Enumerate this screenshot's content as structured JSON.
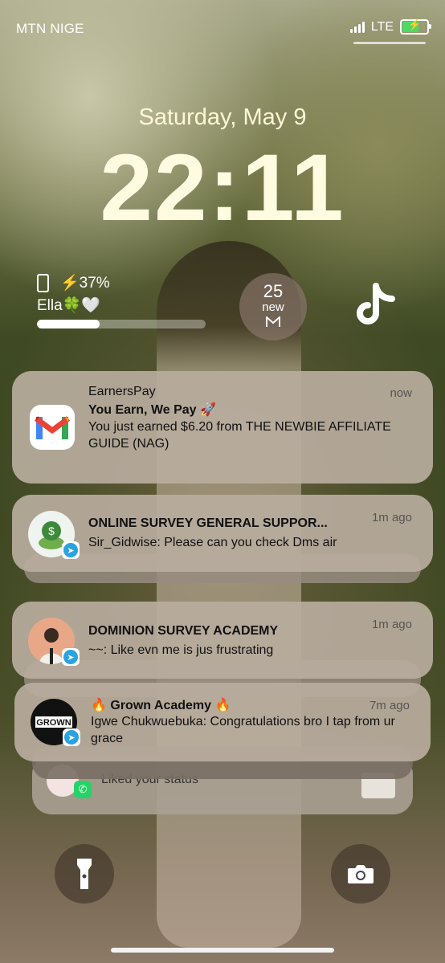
{
  "status_bar": {
    "carrier": "MTN NIGE",
    "network": "LTE",
    "battery_charging": true,
    "battery_level_fraction": 0.7
  },
  "lock_screen": {
    "date": "Saturday, May 9",
    "time": "22:11"
  },
  "widgets": {
    "battery": {
      "percent_label": "⚡37%",
      "device_name": "Ella🍀🤍",
      "level_fraction": 0.37
    },
    "gmail": {
      "count": "25",
      "label": "new"
    },
    "tiktok_icon": "tiktok-icon"
  },
  "notifications": [
    {
      "app": "EarnersPay",
      "title": "You Earn, We Pay 🚀",
      "body": "You just earned $6.20 from THE NEWBIE AFFILIATE GUIDE (NAG)",
      "time": "now",
      "icon": "gmail-icon"
    },
    {
      "title": "ONLINE SURVEY GENERAL SUPPOR...",
      "body": "Sir_Gidwise: Please can you check Dms air",
      "time": "1m ago",
      "icon": "telegram-icon"
    },
    {
      "title": "DOMINION SURVEY ACADEMY",
      "body": "~~: Like evn me is jus frustrating",
      "time": "1m ago",
      "icon": "telegram-icon"
    },
    {
      "title": "🔥 Grown Academy 🔥",
      "body": "Igwe Chukwuebuka: Congratulations bro I tap from ur grace",
      "time": "7m ago",
      "icon": "telegram-icon",
      "avatar_text": "GROWN"
    },
    {
      "body": "Liked your status",
      "icon": "whatsapp-icon"
    }
  ],
  "bottom_controls": {
    "flashlight": "flashlight-icon",
    "camera": "camera-icon"
  },
  "colors": {
    "telegram": "#2aa3e0",
    "whatsapp": "#25d366",
    "battery_green": "#4cd964"
  }
}
